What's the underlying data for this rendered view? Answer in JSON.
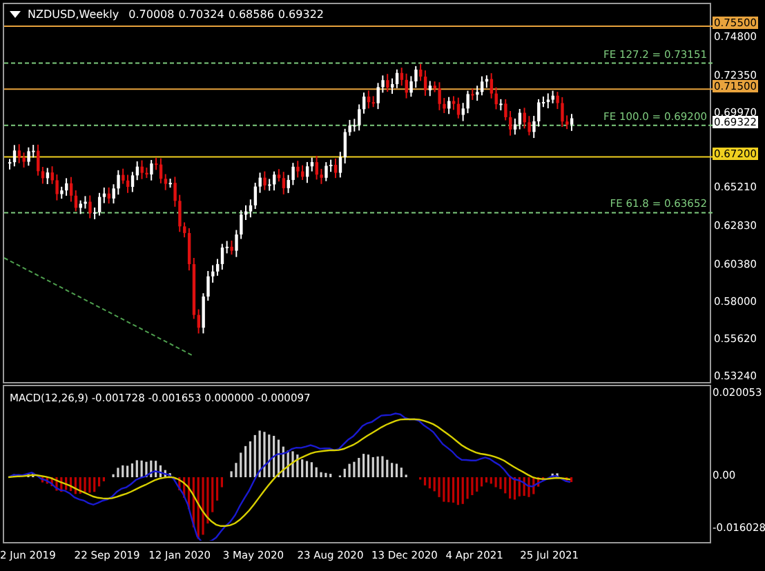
{
  "header": {
    "symbol": "NZDUSD,Weekly",
    "ohlc": [
      "0.70008",
      "0.70324",
      "0.68586",
      "0.69322"
    ]
  },
  "levels": [
    {
      "price": "0.75500",
      "color": "#e8a33d"
    },
    {
      "price": "0.71500",
      "color": "#e8a33d"
    },
    {
      "price": "0.67200",
      "color": "#f0d020"
    }
  ],
  "fibonacci": [
    {
      "label": "FE 127.2 = 0.73151"
    },
    {
      "label": "FE 100.0 = 0.69200"
    },
    {
      "label": "FE 61.8 = 0.63652"
    }
  ],
  "price_axis": [
    {
      "label": "0.74800",
      "kind": "tick"
    },
    {
      "label": "0.72350",
      "kind": "tick"
    },
    {
      "label": "0.69970",
      "kind": "tick"
    },
    {
      "label": "0.69322",
      "kind": "current"
    },
    {
      "label": "0.65210",
      "kind": "tick"
    },
    {
      "label": "0.62830",
      "kind": "tick"
    },
    {
      "label": "0.60380",
      "kind": "tick"
    },
    {
      "label": "0.58000",
      "kind": "tick"
    },
    {
      "label": "0.55620",
      "kind": "tick"
    },
    {
      "label": "0.53240",
      "kind": "tick"
    }
  ],
  "macd": {
    "title": "MACD(12,26,9) -0.001728 -0.001653 0.000000 -0.000097",
    "axis": [
      "0.020053",
      "0.00",
      "-0.016028"
    ]
  },
  "dates": [
    "2 Jun 2019",
    "22 Sep 2019",
    "12 Jan 2020",
    "3 May 2020",
    "23 Aug 2020",
    "13 Dec 2020",
    "4 Apr 2021",
    "25 Jul 2021"
  ]
}
